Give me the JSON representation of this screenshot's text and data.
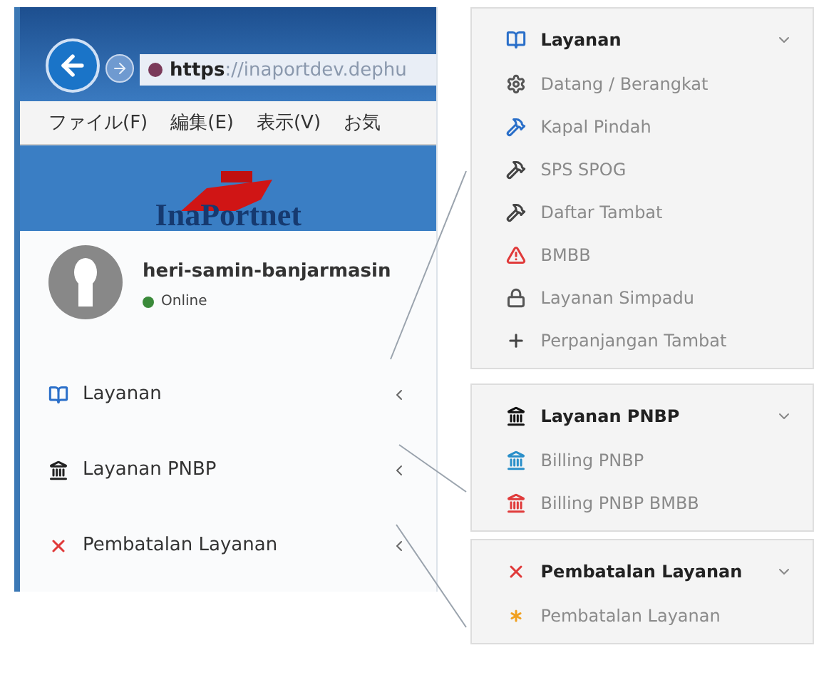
{
  "browser": {
    "url_scheme": "https",
    "url_rest": "://inaportdev.dephu",
    "menu": [
      "ファイル(F)",
      "編集(E)",
      "表示(V)",
      "お気"
    ]
  },
  "app": {
    "logo": "InaPortnet",
    "user": {
      "name": "heri-samin-banjarmasin",
      "status": "Online"
    },
    "nav": [
      {
        "label": "Layanan",
        "kind": "book",
        "color": "#2a6fc9",
        "expanded": false
      },
      {
        "label": "Layanan PNBP",
        "kind": "bank",
        "color": "#222222",
        "expanded": false
      },
      {
        "label": "Pembatalan Layanan",
        "kind": "cross",
        "color": "#e03a3a",
        "expanded": false
      }
    ]
  },
  "panels": [
    {
      "title": "Layanan",
      "kind": "book",
      "color": "#2a6fc9",
      "expanded": true,
      "items": [
        {
          "label": "Datang / Berangkat",
          "kind": "gear",
          "color": "#555555"
        },
        {
          "label": "Kapal Pindah",
          "kind": "hammer",
          "color": "#2a6fc9"
        },
        {
          "label": "SPS SPOG",
          "kind": "hammer",
          "color": "#444444"
        },
        {
          "label": "Daftar Tambat",
          "kind": "hammer",
          "color": "#444444"
        },
        {
          "label": "BMBB",
          "kind": "warning",
          "color": "#e03a3a"
        },
        {
          "label": "Layanan Simpadu",
          "kind": "lock",
          "color": "#555555"
        },
        {
          "label": "Perpanjangan Tambat",
          "kind": "plus",
          "color": "#444444"
        }
      ]
    },
    {
      "title": "Layanan PNBP",
      "kind": "bank",
      "color": "#111111",
      "expanded": true,
      "items": [
        {
          "label": "Billing PNBP",
          "kind": "bank",
          "color": "#2a8fc9"
        },
        {
          "label": "Billing PNBP BMBB",
          "kind": "bank",
          "color": "#e03a3a"
        }
      ]
    },
    {
      "title": "Pembatalan Layanan",
      "kind": "cross",
      "color": "#e03a3a",
      "expanded": true,
      "items": [
        {
          "label": "Pembatalan Layanan",
          "kind": "asterisk",
          "color": "#f0a020"
        }
      ]
    }
  ]
}
